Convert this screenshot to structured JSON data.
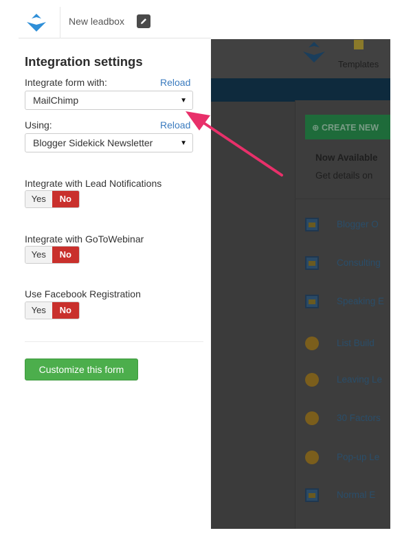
{
  "topbar": {
    "title": "New leadbox"
  },
  "panel": {
    "title": "Integration settings",
    "integrate_label": "Integrate form with:",
    "reload1": "Reload",
    "provider_value": "MailChimp",
    "using_label": "Using:",
    "reload2": "Reload",
    "list_value": "Blogger Sidekick Newsletter",
    "options": [
      {
        "label": "Integrate with Lead Notifications",
        "yes": "Yes",
        "no": "No"
      },
      {
        "label": "Integrate with GoToWebinar",
        "yes": "Yes",
        "no": "No"
      },
      {
        "label": "Use Facebook Registration",
        "yes": "Yes",
        "no": "No"
      }
    ],
    "customize_label": "Customize this form"
  },
  "background": {
    "templates_label": "Templates",
    "create_label": "CREATE NEW",
    "now_available": "Now Available",
    "get_details": "Get details on",
    "items": [
      {
        "icon": "monitor-icon",
        "label": "Blogger O"
      },
      {
        "icon": "monitor-icon",
        "label": "Consulting"
      },
      {
        "icon": "monitor-icon",
        "label": "Speaking E"
      },
      {
        "icon": "coin-icon",
        "label": "List Build"
      },
      {
        "icon": "coin-icon",
        "label": "Leaving Le"
      },
      {
        "icon": "coin-icon",
        "label": "30 Factors"
      },
      {
        "icon": "coin-icon",
        "label": "Pop-up Le"
      },
      {
        "icon": "monitor-icon",
        "label": "Normal E"
      }
    ]
  },
  "colors": {
    "accent_blue": "#3a7bbf",
    "no_red": "#c9302c",
    "customize_green": "#4cae4c",
    "arrow_pink": "#e8306a",
    "logo_blue": "#2f8fd8"
  }
}
